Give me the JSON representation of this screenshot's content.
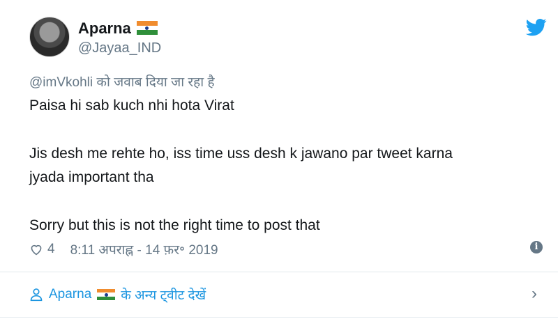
{
  "tweet": {
    "display_name": "Aparna",
    "handle": "@Jayaa_IND",
    "reply_to": "@imVkohli को जवाब दिया जा रहा है",
    "lines": [
      "Paisa hi sab kuch nhi hota Virat",
      "Jis desh me rehte ho, iss time uss desh k jawano par tweet karna",
      "jyada important tha",
      "Sorry but this is not the right time to post that"
    ],
    "likes": "4",
    "timestamp": "8:11 अपराह्न - 14 फ़र॰ 2019",
    "info_glyph": "i",
    "icons": [
      "avatar",
      "india-flag-icon",
      "twitter-bird-icon",
      "heart-icon",
      "info-icon",
      "user-icon",
      "chevron-right-icon"
    ]
  },
  "footer": {
    "user": "Aparna",
    "more_tweets": "के अन्य ट्वीट देखें",
    "chevron": "›"
  },
  "colors": {
    "text": "#14171a",
    "muted": "#657786",
    "link": "#1b95e0",
    "twitter_blue": "#1da1f2",
    "divider": "#e1e8ed"
  }
}
